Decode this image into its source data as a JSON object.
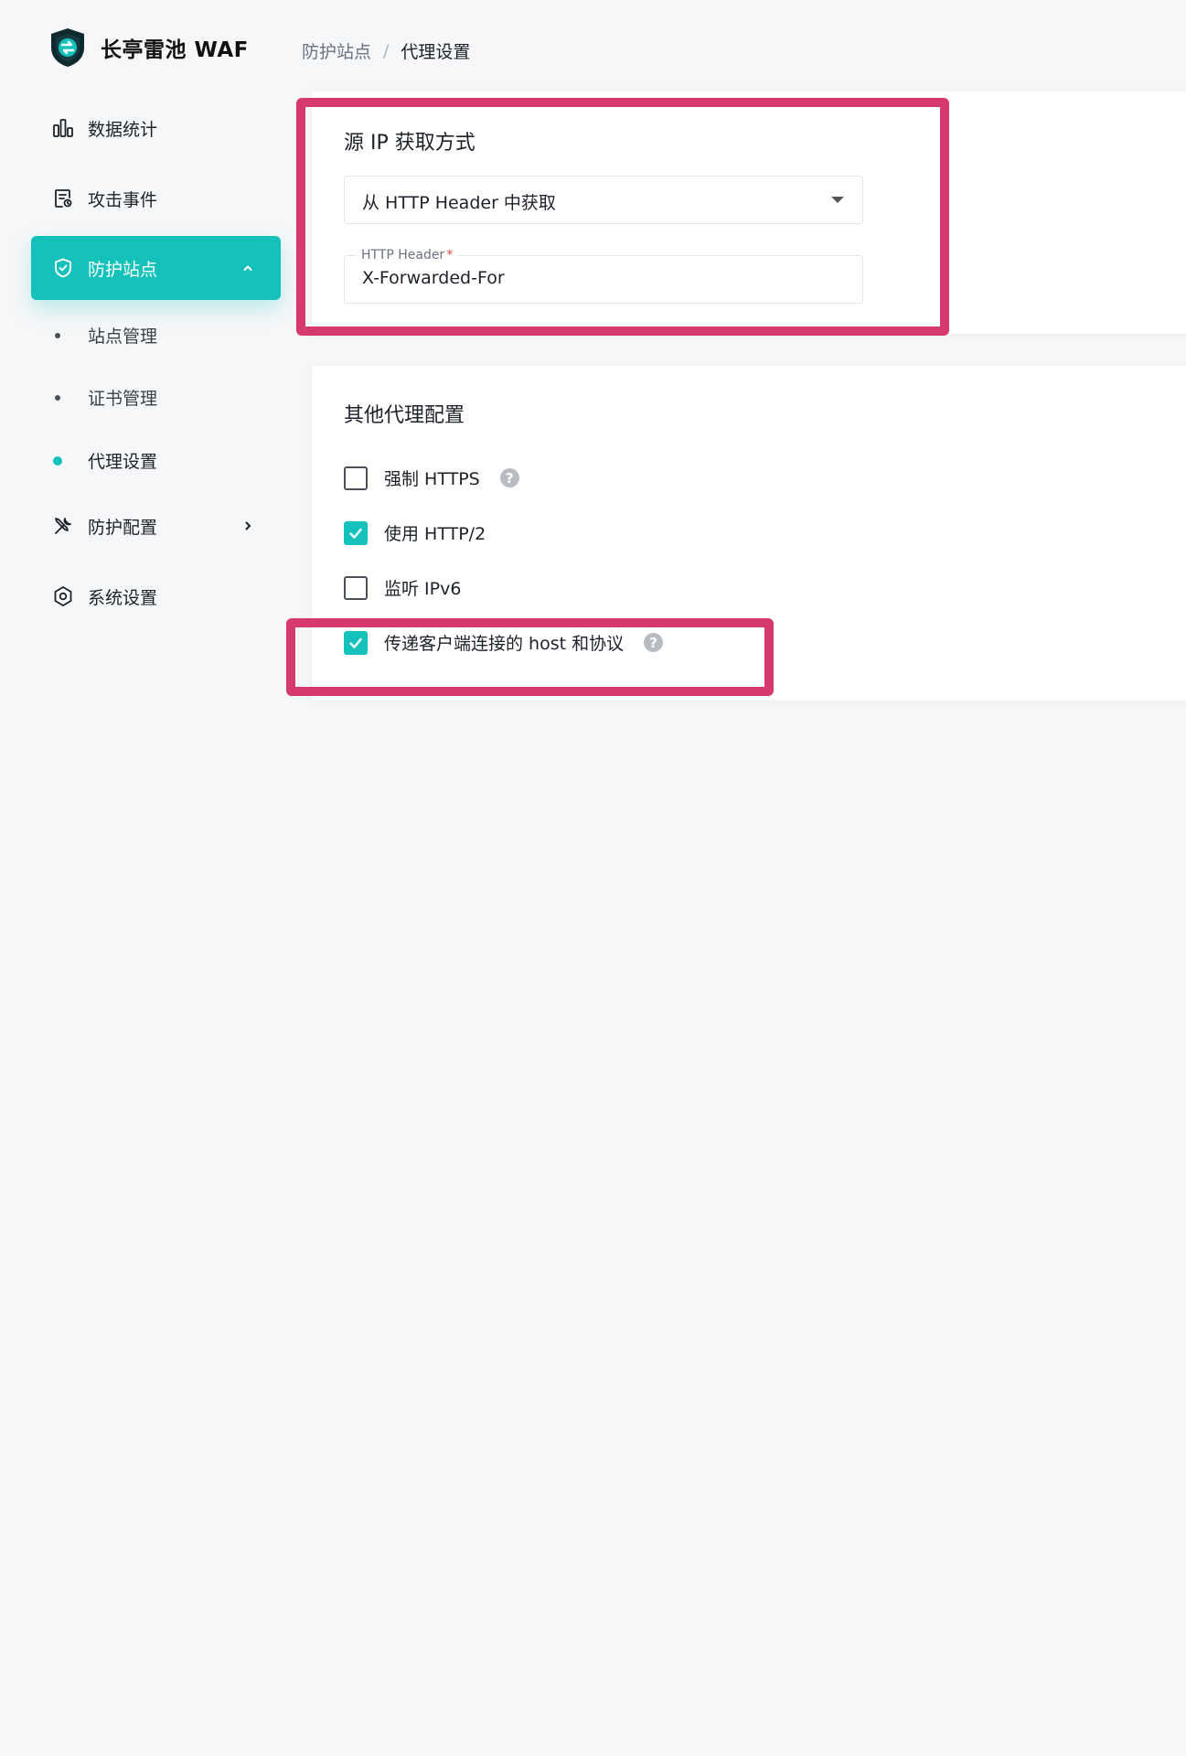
{
  "app": {
    "name": "长亭雷池 WAF",
    "logo_icon": "shield-logo-icon",
    "accent_color": "#14c2bb",
    "highlight_color": "#d6396c"
  },
  "breadcrumb": {
    "parent": "防护站点",
    "separator": "/",
    "current": "代理设置"
  },
  "sidebar": {
    "items": [
      {
        "label": "数据统计",
        "icon": "bar-chart-icon"
      },
      {
        "label": "攻击事件",
        "icon": "document-icon"
      },
      {
        "label": "防护站点",
        "icon": "shield-icon",
        "active": true,
        "expanded": true
      },
      {
        "label": "防护配置",
        "icon": "tools-icon"
      },
      {
        "label": "系统设置",
        "icon": "gear-icon"
      }
    ],
    "sub_items": [
      {
        "label": "站点管理"
      },
      {
        "label": "证书管理"
      },
      {
        "label": "代理设置",
        "active": true
      }
    ]
  },
  "source_ip": {
    "title": "源 IP 获取方式",
    "method_value": "从 HTTP Header 中获取",
    "header_label": "HTTP Header",
    "header_required_mark": "*",
    "header_value": "X-Forwarded-For"
  },
  "other_proxy": {
    "title": "其他代理配置",
    "options": [
      {
        "label": "强制 HTTPS",
        "checked": false,
        "help": "?"
      },
      {
        "label": "使用 HTTP/2",
        "checked": true
      },
      {
        "label": "监听 IPv6",
        "checked": false
      },
      {
        "label": "传递客户端连接的 host 和协议",
        "checked": true,
        "help": "?"
      }
    ]
  }
}
